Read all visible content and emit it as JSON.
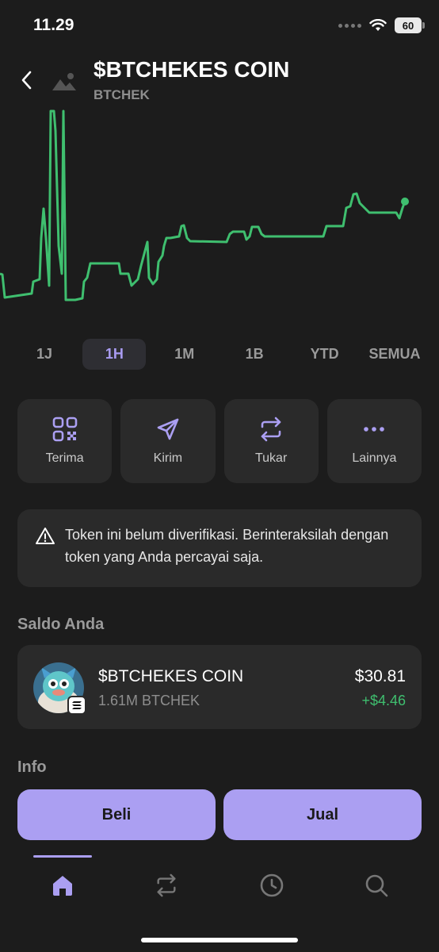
{
  "status_bar": {
    "time": "11.29",
    "battery": "60"
  },
  "header": {
    "title": "$BTCHEKES COIN",
    "symbol": "BTCHEK"
  },
  "chart_data": {
    "type": "line",
    "series": [
      {
        "values": [
          [
            0,
            345
          ],
          [
            3,
            346
          ],
          [
            6,
            375
          ],
          [
            40,
            370
          ],
          [
            42,
            355
          ],
          [
            50,
            352
          ],
          [
            52,
            300
          ],
          [
            55,
            263
          ],
          [
            58,
            300
          ],
          [
            62,
            360
          ],
          [
            64,
            140
          ],
          [
            68,
            140
          ],
          [
            70,
            165
          ],
          [
            74,
            310
          ],
          [
            78,
            345
          ],
          [
            80,
            140
          ],
          [
            83,
            378
          ],
          [
            95,
            378
          ],
          [
            104,
            376
          ],
          [
            106,
            355
          ],
          [
            110,
            350
          ],
          [
            114,
            332
          ],
          [
            150,
            332
          ],
          [
            152,
            345
          ],
          [
            162,
            345
          ],
          [
            166,
            360
          ],
          [
            174,
            352
          ],
          [
            178,
            335
          ],
          [
            182,
            320
          ],
          [
            186,
            305
          ],
          [
            188,
            350
          ],
          [
            193,
            358
          ],
          [
            198,
            352
          ],
          [
            200,
            330
          ],
          [
            205,
            322
          ],
          [
            207,
            310
          ],
          [
            210,
            300
          ],
          [
            215,
            300
          ],
          [
            226,
            298
          ],
          [
            229,
            285
          ],
          [
            232,
            284
          ],
          [
            236,
            300
          ],
          [
            240,
            304
          ],
          [
            286,
            305
          ],
          [
            290,
            295
          ],
          [
            294,
            292
          ],
          [
            308,
            292
          ],
          [
            311,
            302
          ],
          [
            315,
            298
          ],
          [
            318,
            286
          ],
          [
            326,
            286
          ],
          [
            330,
            295
          ],
          [
            334,
            298
          ],
          [
            408,
            298
          ],
          [
            412,
            285
          ],
          [
            433,
            285
          ],
          [
            437,
            262
          ],
          [
            442,
            260
          ],
          [
            446,
            245
          ],
          [
            450,
            244
          ],
          [
            454,
            256
          ],
          [
            460,
            262
          ],
          [
            466,
            268
          ],
          [
            500,
            268
          ],
          [
            504,
            275
          ],
          [
            508,
            262
          ],
          [
            511,
            254
          ]
        ]
      }
    ],
    "color": "#3fbf6f"
  },
  "timeframes": [
    "1J",
    "1H",
    "1M",
    "1B",
    "YTD",
    "SEMUA"
  ],
  "timeframe_active_index": 1,
  "actions": [
    {
      "label": "Terima",
      "icon": "qr-code-icon"
    },
    {
      "label": "Kirim",
      "icon": "send-icon"
    },
    {
      "label": "Tukar",
      "icon": "swap-icon"
    },
    {
      "label": "Lainnya",
      "icon": "more-icon"
    }
  ],
  "warning": {
    "text": "Token ini belum diverifikasi. Berinteraksilah dengan token yang Anda percayai saja."
  },
  "balance": {
    "section_title": "Saldo Anda",
    "name": "$BTCHEKES COIN",
    "amount": "1.61M BTCHEK",
    "value": "$30.81",
    "change": "+$4.46"
  },
  "info": {
    "section_title": "Info"
  },
  "trade": {
    "buy_label": "Beli",
    "sell_label": "Jual"
  },
  "tabbar": {
    "active": "home"
  },
  "colors": {
    "accent": "#ab9ff2",
    "positive": "#3fbf6f",
    "background": "#1c1c1c",
    "card": "#2a2a2a"
  }
}
